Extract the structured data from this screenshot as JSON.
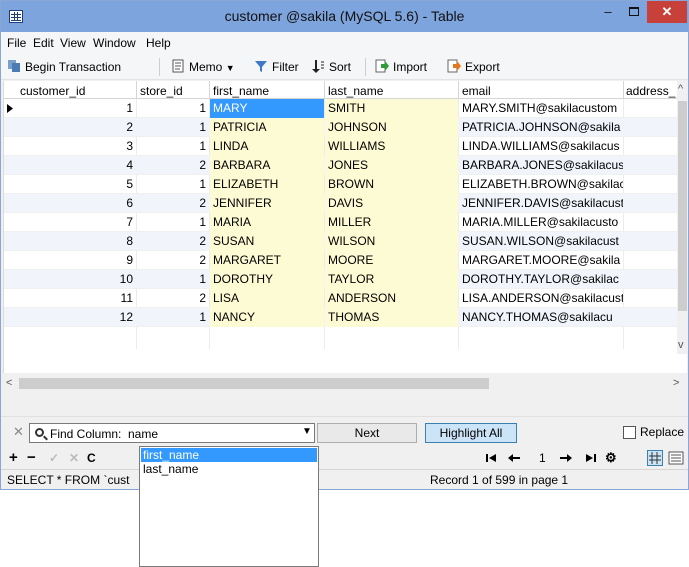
{
  "window": {
    "title": "customer @sakila (MySQL 5.6) - Table",
    "minimize": "–",
    "close": "✕"
  },
  "menu": [
    "File",
    "Edit",
    "View",
    "Window",
    "Help"
  ],
  "toolbar": {
    "begin_transaction": "Begin Transaction",
    "memo": "Memo",
    "filter": "Filter",
    "sort": "Sort",
    "import": "Import",
    "export": "Export"
  },
  "columns": [
    "customer_id",
    "store_id",
    "first_name",
    "last_name",
    "email",
    "address_i"
  ],
  "rows": [
    {
      "customer_id": "1",
      "store_id": "1",
      "first_name": "MARY",
      "last_name": "SMITH",
      "email": "MARY.SMITH@sakilacustom"
    },
    {
      "customer_id": "2",
      "store_id": "1",
      "first_name": "PATRICIA",
      "last_name": "JOHNSON",
      "email": "PATRICIA.JOHNSON@sakila"
    },
    {
      "customer_id": "3",
      "store_id": "1",
      "first_name": "LINDA",
      "last_name": "WILLIAMS",
      "email": "LINDA.WILLIAMS@sakilacus"
    },
    {
      "customer_id": "4",
      "store_id": "2",
      "first_name": "BARBARA",
      "last_name": "JONES",
      "email": "BARBARA.JONES@sakilacust"
    },
    {
      "customer_id": "5",
      "store_id": "1",
      "first_name": "ELIZABETH",
      "last_name": "BROWN",
      "email": "ELIZABETH.BROWN@sakilac"
    },
    {
      "customer_id": "6",
      "store_id": "2",
      "first_name": "JENNIFER",
      "last_name": "DAVIS",
      "email": "JENNIFER.DAVIS@sakilacust"
    },
    {
      "customer_id": "7",
      "store_id": "1",
      "first_name": "MARIA",
      "last_name": "MILLER",
      "email": "MARIA.MILLER@sakilacusto"
    },
    {
      "customer_id": "8",
      "store_id": "2",
      "first_name": "SUSAN",
      "last_name": "WILSON",
      "email": "SUSAN.WILSON@sakilacust"
    },
    {
      "customer_id": "9",
      "store_id": "2",
      "first_name": "MARGARET",
      "last_name": "MOORE",
      "email": "MARGARET.MOORE@sakila"
    },
    {
      "customer_id": "10",
      "store_id": "1",
      "first_name": "DOROTHY",
      "last_name": "TAYLOR",
      "email": "DOROTHY.TAYLOR@sakilac"
    },
    {
      "customer_id": "11",
      "store_id": "2",
      "first_name": "LISA",
      "last_name": "ANDERSON",
      "email": "LISA.ANDERSON@sakilacust"
    },
    {
      "customer_id": "12",
      "store_id": "1",
      "first_name": "NANCY",
      "last_name": "THOMAS",
      "email": "NANCY.THOMAS@sakilacu"
    }
  ],
  "find": {
    "label": "Find Column:",
    "value": "name",
    "next": "Next",
    "highlight_all": "Highlight All",
    "replace": "Replace",
    "suggestions": [
      "first_name",
      "last_name"
    ]
  },
  "nav": {
    "page": "1"
  },
  "status": {
    "sql": "SELECT * FROM `cust",
    "record": "Record 1 of 599 in page 1"
  },
  "colors": {
    "titlebar": "#7ea4dd",
    "close": "#c7413a",
    "selection": "#3399ff",
    "highlight_cell": "#fdfbd3"
  }
}
